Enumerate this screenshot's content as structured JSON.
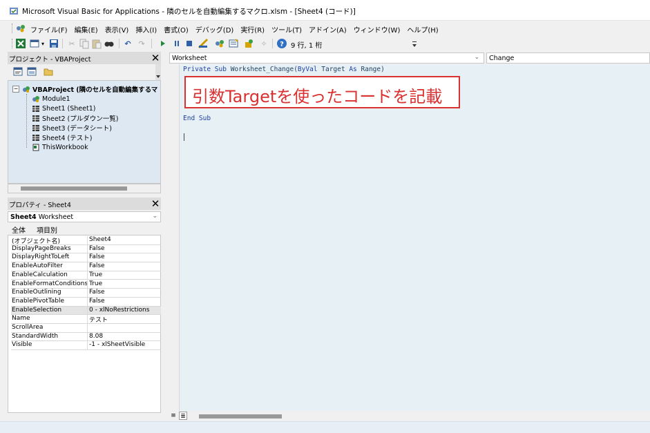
{
  "window": {
    "title": "Microsoft Visual Basic for Applications - 隣のセルを自動編集するマクロ.xlsm - [Sheet4 (コード)]"
  },
  "menu": {
    "items": [
      "ファイル(F)",
      "編集(E)",
      "表示(V)",
      "挿入(I)",
      "書式(O)",
      "デバッグ(D)",
      "実行(R)",
      "ツール(T)",
      "アドイン(A)",
      "ウィンドウ(W)",
      "ヘルプ(H)"
    ]
  },
  "toolbar": {
    "position_text": "9 行, 1 桁",
    "icons": [
      "excel-icon",
      "insert-module-icon",
      "save-icon",
      "cut-icon",
      "copy-icon",
      "paste-icon",
      "find-icon",
      "undo-icon",
      "redo-icon",
      "run-icon",
      "break-icon",
      "reset-icon",
      "design-mode-icon",
      "project-explorer-icon",
      "properties-icon",
      "object-browser-icon",
      "toolbox-icon",
      "help-icon"
    ]
  },
  "project_panel": {
    "title": "プロジェクト - VBAProject",
    "root": "VBAProject (隣のセルを自動編集するマ",
    "items": [
      "Module1",
      "Sheet1 (Sheet1)",
      "Sheet2 (プルダウン一覧)",
      "Sheet3 (データシート)",
      "Sheet4 (テスト)",
      "ThisWorkbook"
    ]
  },
  "properties_panel": {
    "title": "プロパティ - Sheet4",
    "selected_object": "Sheet4",
    "selected_type": "Worksheet",
    "tabs": [
      "全体",
      "項目別"
    ],
    "rows": [
      {
        "k": "(オブジェクト名)",
        "v": "Sheet4"
      },
      {
        "k": "DisplayPageBreaks",
        "v": "False"
      },
      {
        "k": "DisplayRightToLeft",
        "v": "False"
      },
      {
        "k": "EnableAutoFilter",
        "v": "False"
      },
      {
        "k": "EnableCalculation",
        "v": "True"
      },
      {
        "k": "EnableFormatConditions",
        "v": "True"
      },
      {
        "k": "EnableOutlining",
        "v": "False"
      },
      {
        "k": "EnablePivotTable",
        "v": "False"
      },
      {
        "k": "EnableSelection",
        "v": "0 - xlNoRestrictions"
      },
      {
        "k": "Name",
        "v": "テスト"
      },
      {
        "k": "ScrollArea",
        "v": ""
      },
      {
        "k": "StandardWidth",
        "v": "8.08"
      },
      {
        "k": "Visible",
        "v": "-1 - xlSheetVisible"
      }
    ]
  },
  "code_window": {
    "object_select": "Worksheet",
    "procedure_select": "Change",
    "line1_kw1": "Private",
    "line1_kw2": "Sub",
    "line1_name": "Worksheet_Change(",
    "line1_kw3": "ByVal",
    "line1_mid": "Target",
    "line1_kw4": "As",
    "line1_end": "Range)",
    "line_end": "End Sub",
    "annotation": "引数Targetを使ったコードを記載"
  },
  "colors": {
    "annotation_red": "#d93030",
    "code_bg": "#e6f0f5",
    "tree_bg": "#dde8f3"
  }
}
